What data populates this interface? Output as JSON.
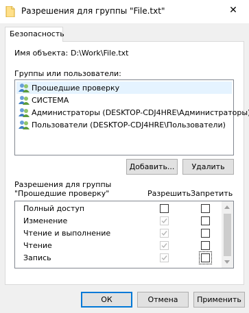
{
  "window": {
    "title": "Разрешения для группы \"File.txt\"",
    "icon": "folder-file-icon",
    "close_symbol": "✕"
  },
  "tab": {
    "label": "Безопасность"
  },
  "object": {
    "label": "Имя объекта:",
    "value": "D:\\Work\\File.txt"
  },
  "groups": {
    "label": "Группы или пользователи:",
    "items": [
      {
        "label": "Прошедшие проверку",
        "selected": true
      },
      {
        "label": "СИСТЕМА",
        "selected": false
      },
      {
        "label": "Администраторы (DESKTOP-CDJ4HRE\\Администраторы)",
        "selected": false
      },
      {
        "label": "Пользователи (DESKTOP-CDJ4HRE\\Пользователи)",
        "selected": false
      }
    ]
  },
  "buttons": {
    "add": "Добавить...",
    "remove": "Удалить",
    "ok": "ОК",
    "cancel": "Отмена",
    "apply": "Применить"
  },
  "permissions": {
    "header_line1": "Разрешения для группы",
    "header_line2": "\"Прошедшие проверку\"",
    "allow_label": "Разрешить",
    "deny_label": "Запретить",
    "rows": [
      {
        "name": "Полный доступ",
        "allow": false,
        "allow_disabled": false,
        "deny": false
      },
      {
        "name": "Изменение",
        "allow": true,
        "allow_disabled": true,
        "deny": false
      },
      {
        "name": "Чтение и выполнение",
        "allow": true,
        "allow_disabled": true,
        "deny": false
      },
      {
        "name": "Чтение",
        "allow": true,
        "allow_disabled": true,
        "deny": false
      },
      {
        "name": "Запись",
        "allow": true,
        "allow_disabled": true,
        "deny": false
      }
    ]
  },
  "colors": {
    "selection": "#e5f3ff",
    "accent": "#0078d7",
    "folder": "#ffd86e"
  }
}
